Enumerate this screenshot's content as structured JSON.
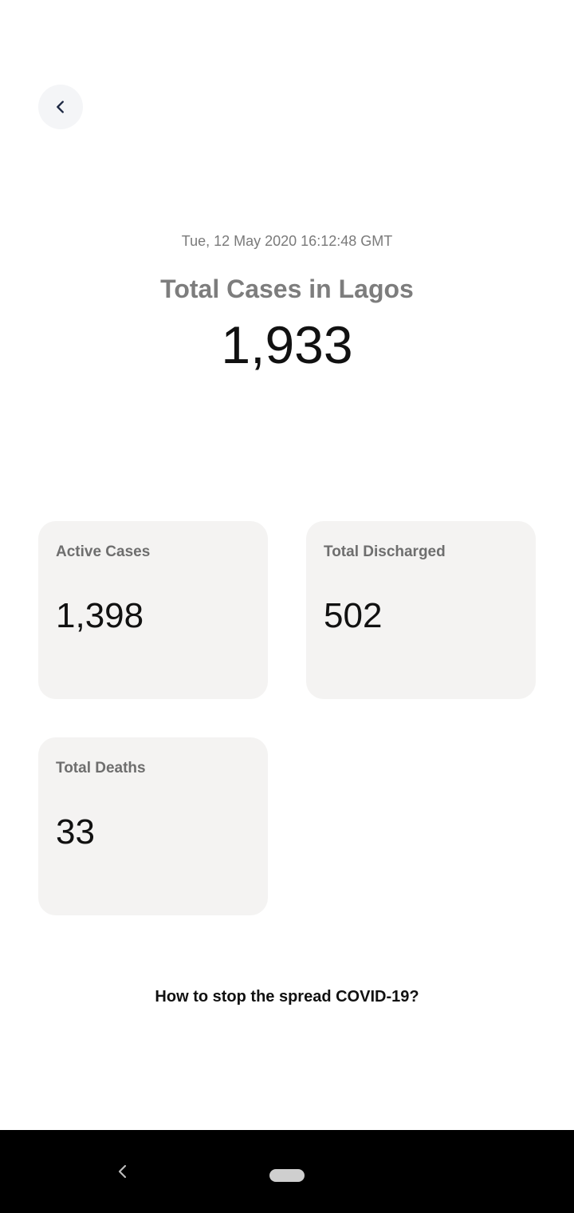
{
  "header": {
    "back_icon": "chevron-left-icon"
  },
  "summary": {
    "timestamp": "Tue, 12 May 2020 16:12:48 GMT",
    "title": "Total Cases in Lagos",
    "total_cases": "1,933"
  },
  "cards": {
    "active": {
      "label": "Active Cases",
      "value": "1,398"
    },
    "discharged": {
      "label": "Total Discharged",
      "value": "502"
    },
    "deaths": {
      "label": "Total Deaths",
      "value": "33"
    }
  },
  "footer": {
    "link_text": "How to stop the spread COVID-19?"
  },
  "system_nav": {
    "back_icon": "nav-back-icon",
    "home_icon": "nav-home-pill-icon"
  },
  "colors": {
    "card_background": "#f4f3f2",
    "back_button_background": "#f4f5f7",
    "nav_bar": "#000000"
  }
}
